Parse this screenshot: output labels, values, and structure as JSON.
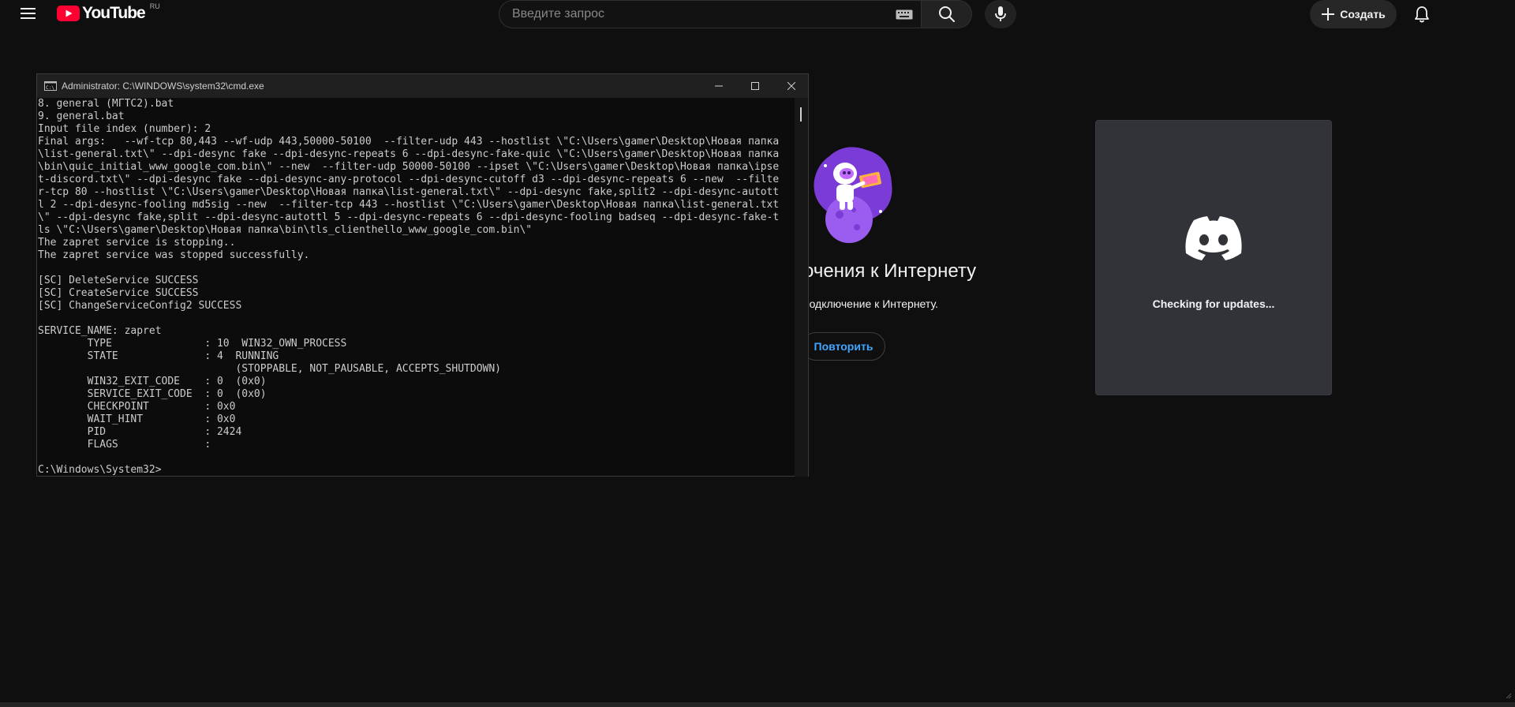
{
  "youtube": {
    "logo_text": "YouTube",
    "region": "RU",
    "search_placeholder": "Введите запрос",
    "create_label": "Создать",
    "icons": {
      "menu": "hamburger-icon",
      "search": "search-icon",
      "mic": "microphone-icon",
      "keyboard": "keyboard-icon",
      "create": "plus-icon",
      "notifications": "bell-icon"
    }
  },
  "offline": {
    "title": "очения к Интернету",
    "message": "подключение к Интернету.",
    "retry_label": "Повторить"
  },
  "discord": {
    "status": "Checking for updates..."
  },
  "cmd": {
    "title": "Administrator: C:\\WINDOWS\\system32\\cmd.exe",
    "lines": [
      "8. general (МГТС2).bat",
      "9. general.bat",
      "Input file index (number): 2",
      "Final args:   --wf-tcp 80,443 --wf-udp 443,50000-50100  --filter-udp 443 --hostlist \\\"C:\\Users\\gamer\\Desktop\\Новая папка",
      "\\list-general.txt\\\" --dpi-desync fake --dpi-desync-repeats 6 --dpi-desync-fake-quic \\\"C:\\Users\\gamer\\Desktop\\Новая папка",
      "\\bin\\quic_initial_www_google_com.bin\\\" --new  --filter-udp 50000-50100 --ipset \\\"C:\\Users\\gamer\\Desktop\\Новая папка\\ipse",
      "t-discord.txt\\\" --dpi-desync fake --dpi-desync-any-protocol --dpi-desync-cutoff d3 --dpi-desync-repeats 6 --new  --filte",
      "r-tcp 80 --hostlist \\\"C:\\Users\\gamer\\Desktop\\Новая папка\\list-general.txt\\\" --dpi-desync fake,split2 --dpi-desync-autott",
      "l 2 --dpi-desync-fooling md5sig --new  --filter-tcp 443 --hostlist \\\"C:\\Users\\gamer\\Desktop\\Новая папка\\list-general.txt",
      "\\\" --dpi-desync fake,split --dpi-desync-autottl 5 --dpi-desync-repeats 6 --dpi-desync-fooling badseq --dpi-desync-fake-t",
      "ls \\\"C:\\Users\\gamer\\Desktop\\Новая папка\\bin\\tls_clienthello_www_google_com.bin\\\"",
      "The zapret service is stopping..",
      "The zapret service was stopped successfully.",
      "",
      "[SC] DeleteService SUCCESS",
      "[SC] CreateService SUCCESS",
      "[SC] ChangeServiceConfig2 SUCCESS",
      "",
      "SERVICE_NAME: zapret",
      "        TYPE               : 10  WIN32_OWN_PROCESS",
      "        STATE              : 4  RUNNING",
      "                                (STOPPABLE, NOT_PAUSABLE, ACCEPTS_SHUTDOWN)",
      "        WIN32_EXIT_CODE    : 0  (0x0)",
      "        SERVICE_EXIT_CODE  : 0  (0x0)",
      "        CHECKPOINT         : 0x0",
      "        WAIT_HINT          : 0x0",
      "        PID                : 2424",
      "        FLAGS              :",
      "",
      "C:\\Windows\\System32>"
    ]
  }
}
